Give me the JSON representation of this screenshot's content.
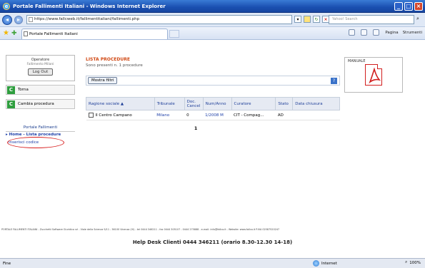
{
  "window": {
    "title": "Portale Fallimenti Italiani - Windows Internet Explorer",
    "minimize": "_",
    "maximize": "□",
    "close": "×"
  },
  "addressbar": {
    "url": "https://www.fallcweb.it/fallimentitaliani/fallimenti.php",
    "search_placeholder": "Yahoo! Search"
  },
  "favorites": {
    "tab_title": "Portale Fallimenti Italiani",
    "tools": [
      "Pagina",
      "Strumenti"
    ]
  },
  "sidebar": {
    "operator_label": "Operatore",
    "operator_name": "Fallimento Milani",
    "logout_label": "Log Out",
    "items": [
      {
        "label": "Torna"
      },
      {
        "label": "Cambia procedura"
      }
    ],
    "portal_heading": "Portale Fallimenti",
    "home_link": "▸ Home - Lista procedure",
    "insert_code": "Inserisci codice"
  },
  "main": {
    "title": "LISTA PROCEDURE",
    "subtitle": "Sono presenti n. 1 procedure",
    "filter_button": "Mostra filtri",
    "help": "?",
    "columns": [
      "Ragione sociale ▲",
      "Tribunale",
      "Doc. Cancel",
      "Num/Anno",
      "Curatore",
      "Stato",
      "Data chiusura"
    ],
    "rows": [
      [
        "Il Centro Campano",
        "Milano",
        "0",
        "1/2008 M",
        "CIT - Compag...",
        "AD",
        ""
      ]
    ],
    "pager": "1"
  },
  "manual": {
    "label": "MANUALE",
    "icon": "pdf-icon"
  },
  "footer": {
    "company_line": "PORTALE FALLIMENTI ITALIANI - Zucchetti Software Giuridico srl - Viale della Scienza 9/11 - 36100 Vicenza (VI) - tel 0444 346211 - fax 0444 305107 - 0444 275888 - e-mail: info@fallco.it - Website: www.fallco.it P.IVA 02587520247",
    "helpdesk": "Help Desk Clienti 0444 346211 (orario 8.30-12.30 14-18)"
  },
  "statusbar": {
    "left": "Fine",
    "zone": "Internet",
    "zoom": "100%"
  },
  "colors": {
    "accent": "#1a4fb0",
    "title_orange": "#d14a16",
    "link_blue": "#1d3fa8",
    "annotation_red": "#d81c1c",
    "green_icon": "#2e9e3e"
  }
}
